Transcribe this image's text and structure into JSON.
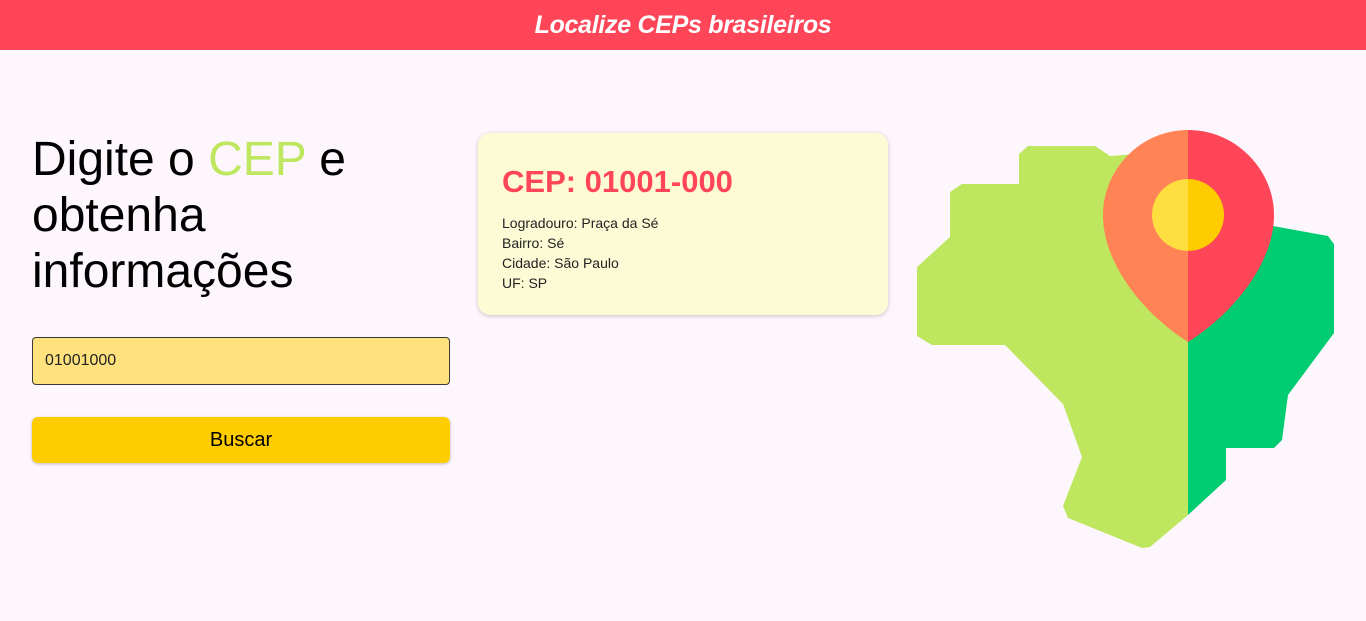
{
  "header": {
    "title": "Localize CEPs brasileiros"
  },
  "headline": {
    "part1": "Digite o ",
    "accent": "CEP",
    "part2": " e obtenha informações"
  },
  "search": {
    "input_value": "01001000",
    "button_label": "Buscar"
  },
  "result": {
    "title": "CEP: 01001-000",
    "logradouro": "Logradouro: Praça da Sé",
    "bairro": "Bairro: Sé",
    "cidade": "Cidade: São Paulo",
    "uf": "UF: SP"
  },
  "colors": {
    "header_bg": "#ff4558",
    "accent_green": "#bee75f",
    "input_bg": "#ffe17e",
    "button_bg": "#ffcc00",
    "card_bg": "#fdfbd6",
    "cep_title": "#ff4558",
    "map_light_green": "#bee75f",
    "map_dark_green": "#00cc71",
    "pin_orange": "#ff8355",
    "pin_red": "#ff4558",
    "pin_center_light": "#ffdf40",
    "pin_center_dark": "#ffcc00"
  },
  "icons": {
    "illustration": "brazil-map-location-pin-icon"
  }
}
